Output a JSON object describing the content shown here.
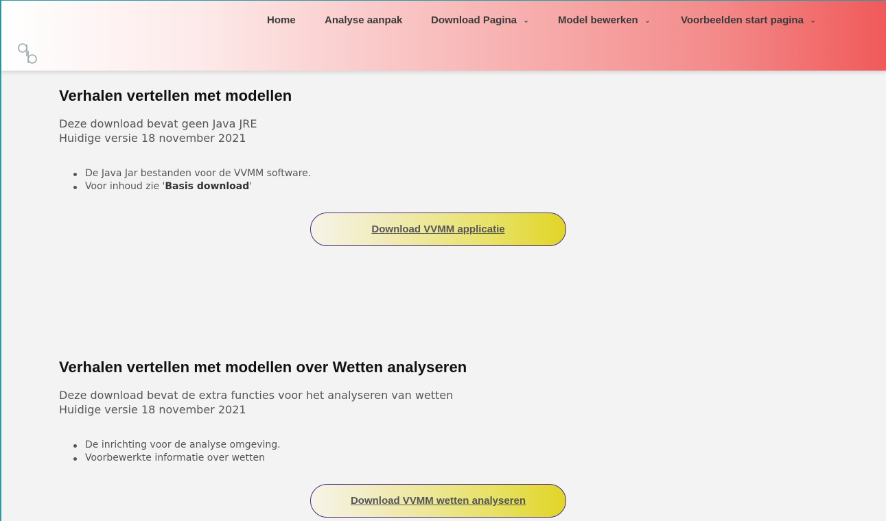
{
  "nav": {
    "home": "Home",
    "analyse": "Analyse aanpak",
    "download": "Download Pagina",
    "model": "Model bewerken",
    "voorbeelden": "Voorbeelden start pagina"
  },
  "sections": [
    {
      "title": "Verhalen vertellen met modellen",
      "desc_line1": "Deze download bevat geen Java JRE",
      "desc_line2": "Huidige versie 18 november 2021",
      "bullet1": "De Java Jar bestanden voor de VVMM software.",
      "bullet2_prefix": "Voor inhoud zie '",
      "bullet2_bold": "Basis download",
      "bullet2_suffix": "'",
      "button": "Download VVMM applicatie"
    },
    {
      "title": "Verhalen vertellen met modellen over Wetten analyseren",
      "desc_line1": "Deze download bevat de extra functies voor het analyseren van wetten",
      "desc_line2": "Huidige versie 18 november 2021",
      "bullet1": "De inrichting voor de analyse omgeving.",
      "bullet2": "Voorbewerkte informatie over wetten",
      "button": "Download VVMM wetten analyseren"
    }
  ],
  "colors": {
    "header_gradient_end": "#f05a5a",
    "button_border": "#4b2a7e",
    "button_gradient_end": "#e1d527"
  }
}
